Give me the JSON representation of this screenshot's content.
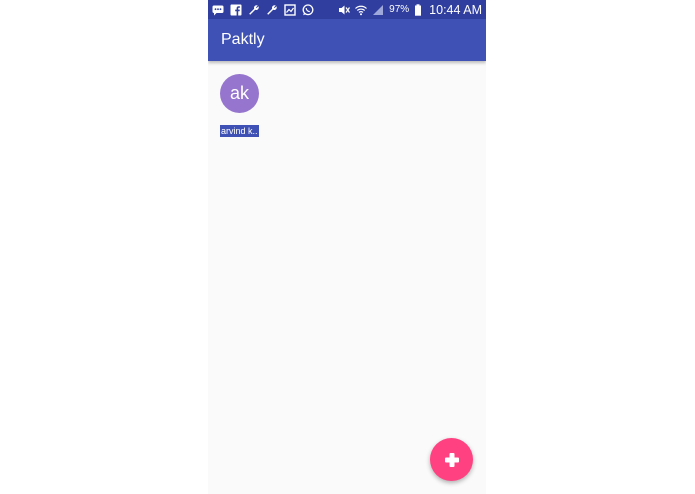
{
  "status_bar": {
    "left_icons": [
      "chat-icon",
      "facebook-icon",
      "wrench-icon",
      "wrench-icon",
      "image-icon",
      "whatsapp-icon"
    ],
    "right_icons": [
      "mute-icon",
      "wifi-icon",
      "signal-icon",
      "battery-icon"
    ],
    "battery": "97%",
    "time": "10:44 AM"
  },
  "app_bar": {
    "title": "Paktly",
    "color": "#3f51b5"
  },
  "contacts": [
    {
      "initials": "ak",
      "name": "arvind k..",
      "avatar_color": "#9575cd"
    }
  ],
  "fab": {
    "icon": "plus-icon",
    "color": "#ff4081"
  }
}
